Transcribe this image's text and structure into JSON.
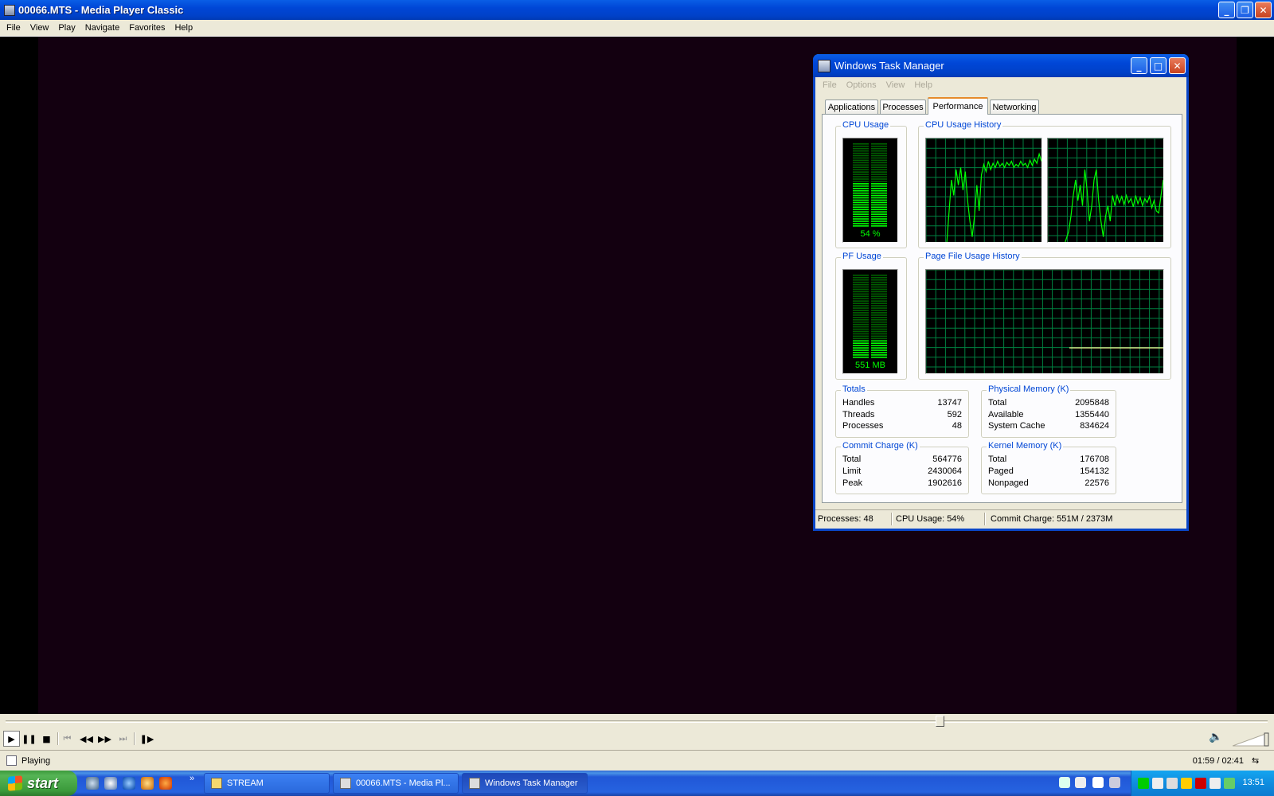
{
  "mpc": {
    "title": "00066.MTS - Media Player Classic",
    "menu": [
      "File",
      "View",
      "Play",
      "Navigate",
      "Favorites",
      "Help"
    ],
    "status": "Playing",
    "time": "01:59 / 02:41",
    "seek_fraction": 0.74
  },
  "taskmgr": {
    "title": "Windows Task Manager",
    "menu": [
      "File",
      "Options",
      "View",
      "Help"
    ],
    "tabs": [
      "Applications",
      "Processes",
      "Performance",
      "Networking"
    ],
    "active_tab": "Performance",
    "cpu_usage_label": "CPU Usage",
    "cpu_usage_value": "54 %",
    "cpu_usage_fraction": 0.54,
    "cpu_history_label": "CPU Usage History",
    "pf_usage_label": "PF Usage",
    "pf_usage_value": "551 MB",
    "pf_usage_fraction": 0.23,
    "pf_history_label": "Page File Usage History",
    "totals": {
      "label": "Totals",
      "rows": [
        {
          "k": "Handles",
          "v": "13747"
        },
        {
          "k": "Threads",
          "v": "592"
        },
        {
          "k": "Processes",
          "v": "48"
        }
      ]
    },
    "physical": {
      "label": "Physical Memory (K)",
      "rows": [
        {
          "k": "Total",
          "v": "2095848"
        },
        {
          "k": "Available",
          "v": "1355440"
        },
        {
          "k": "System Cache",
          "v": "834624"
        }
      ]
    },
    "commit": {
      "label": "Commit Charge (K)",
      "rows": [
        {
          "k": "Total",
          "v": "564776"
        },
        {
          "k": "Limit",
          "v": "2430064"
        },
        {
          "k": "Peak",
          "v": "1902616"
        }
      ]
    },
    "kernel": {
      "label": "Kernel Memory (K)",
      "rows": [
        {
          "k": "Total",
          "v": "176708"
        },
        {
          "k": "Paged",
          "v": "154132"
        },
        {
          "k": "Nonpaged",
          "v": "22576"
        }
      ]
    },
    "statusbar": {
      "processes": "Processes: 48",
      "cpu": "CPU Usage: 54%",
      "commit": "Commit Charge: 551M / 2373M"
    }
  },
  "taskbar": {
    "start": "start",
    "buttons": [
      "STREAM",
      "00066.MTS - Media Pl...",
      "Windows Task Manager"
    ],
    "active_button": "Windows Task Manager",
    "clock": "13:51",
    "overflow": "»"
  },
  "colors": {
    "xp_blue": "#0046d6",
    "xp_beige": "#ece9d8",
    "graph_green": "#00ff00",
    "graph_grid": "#008040",
    "video_bg": "#130010"
  },
  "icons": {
    "play": "play-icon",
    "pause": "pause-icon",
    "stop": "stop-icon",
    "volume": "speaker-icon"
  }
}
